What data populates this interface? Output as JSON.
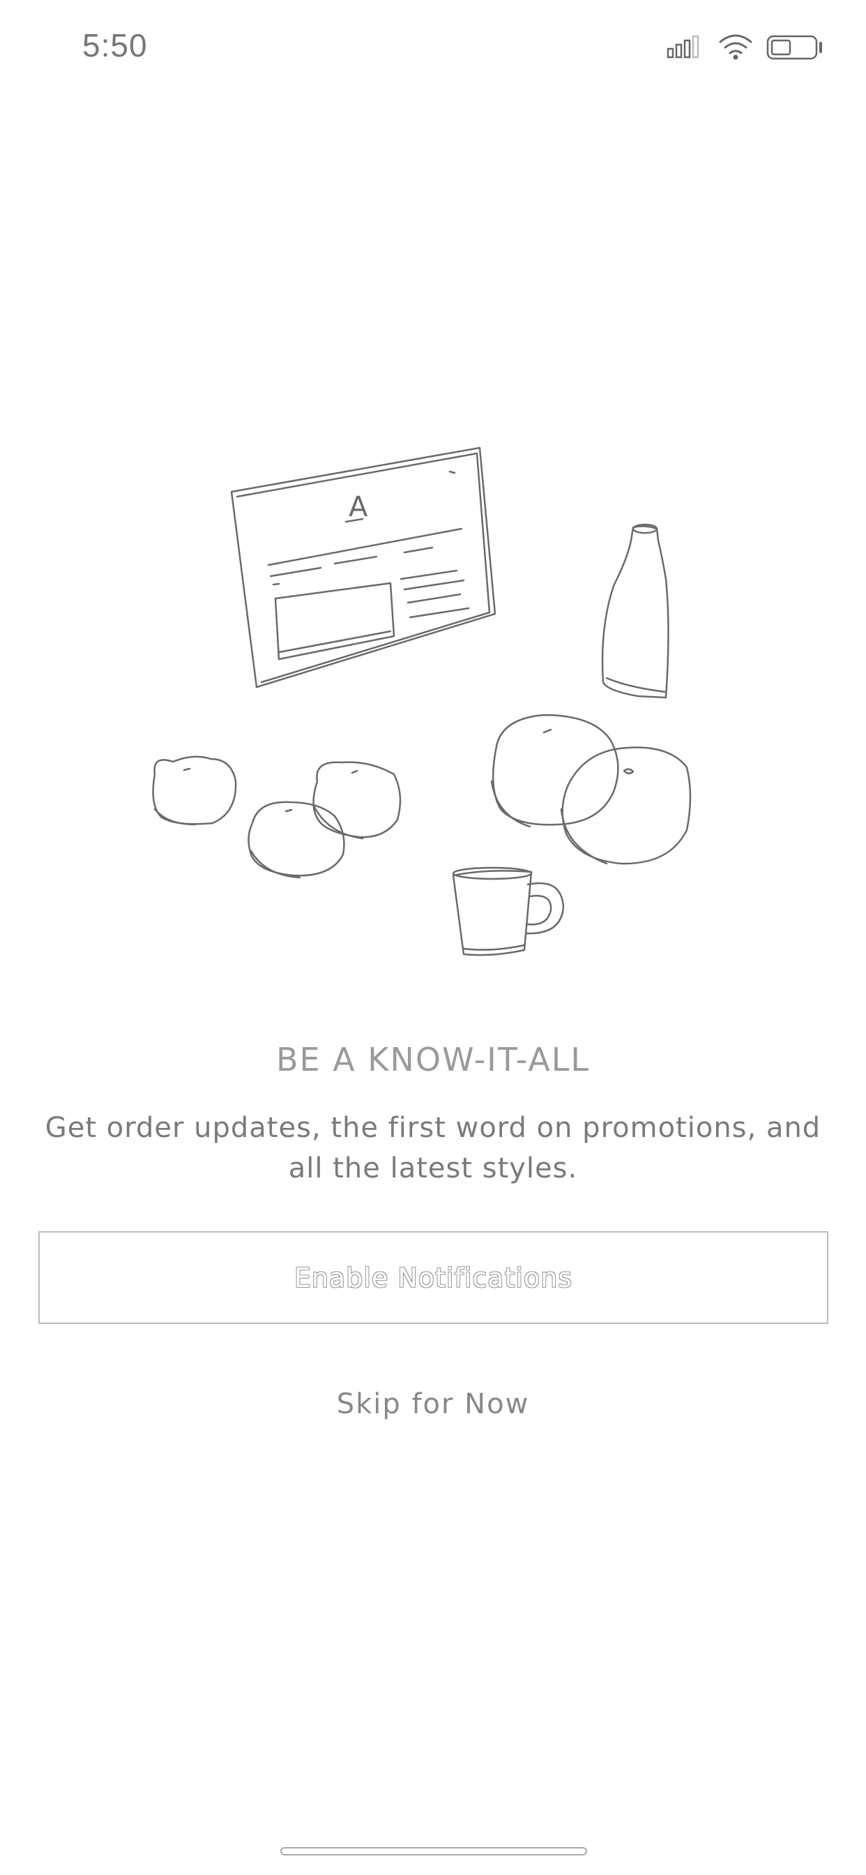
{
  "status_bar": {
    "time": "5:50",
    "icons": [
      "signal-icon",
      "wifi-icon",
      "battery-icon"
    ]
  },
  "illustration": {
    "name": "sketch-illustration",
    "tablet_letter": "A"
  },
  "content": {
    "headline": "BE A KNOW-IT-ALL",
    "subtext": "Get order updates, the first word on promotions, and all the latest styles."
  },
  "actions": {
    "enable_label": "Enable Notifications",
    "skip_label": "Skip for Now"
  },
  "colors": {
    "background": "#ffffff",
    "text_primary": "#7a7a7a",
    "stroke": "#6a6a6a"
  }
}
